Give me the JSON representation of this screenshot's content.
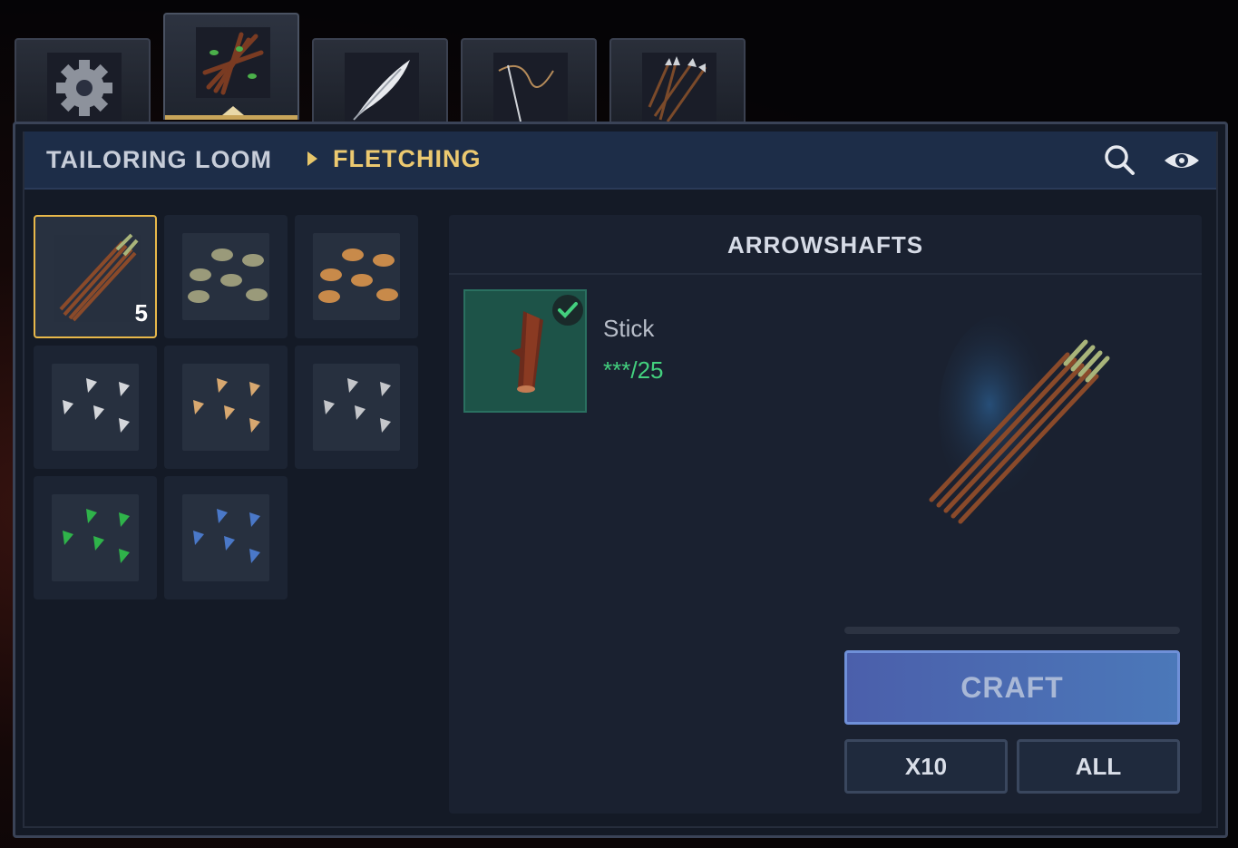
{
  "tabs": [
    {
      "name": "settings",
      "icon": "gear-icon"
    },
    {
      "name": "sticks",
      "icon": "sticks-icon",
      "active": true
    },
    {
      "name": "feathers",
      "icon": "feather-icon"
    },
    {
      "name": "bowstring",
      "icon": "bowstring-icon"
    },
    {
      "name": "arrows",
      "icon": "arrows-icon"
    }
  ],
  "header": {
    "crumb_parent": "TAILORING LOOM",
    "crumb_current": "FLETCHING",
    "search_icon": "search-icon",
    "visibility_icon": "eye-icon"
  },
  "recipes": [
    {
      "name": "arrowshafts",
      "icon": "arrowshafts-icon",
      "count": "5",
      "selected": true
    },
    {
      "name": "flint-arrowheads",
      "icon": "flint-arrowheads-icon"
    },
    {
      "name": "copper-arrowheads",
      "icon": "copper-arrowheads-icon"
    },
    {
      "name": "iron-arrowheads",
      "icon": "iron-arrowheads-icon"
    },
    {
      "name": "bronze-arrowheads",
      "icon": "bronze-arrowheads-icon"
    },
    {
      "name": "silver-arrowheads",
      "icon": "silver-arrowheads-icon"
    },
    {
      "name": "jade-arrowheads",
      "icon": "jade-arrowheads-icon"
    },
    {
      "name": "sapphire-arrowheads",
      "icon": "sapphire-arrowheads-icon"
    }
  ],
  "detail": {
    "title": "ARROWSHAFTS",
    "ingredient": {
      "name": "Stick",
      "quantity": "***/25",
      "icon": "stick-icon",
      "satisfied": true
    },
    "progress": 0,
    "craft_label": "CRAFT",
    "x10_label": "X10",
    "all_label": "ALL"
  },
  "colors": {
    "accent_gold": "#e8b84a",
    "ok_green": "#43d07e",
    "craft_blue": "#4b6ab2"
  }
}
